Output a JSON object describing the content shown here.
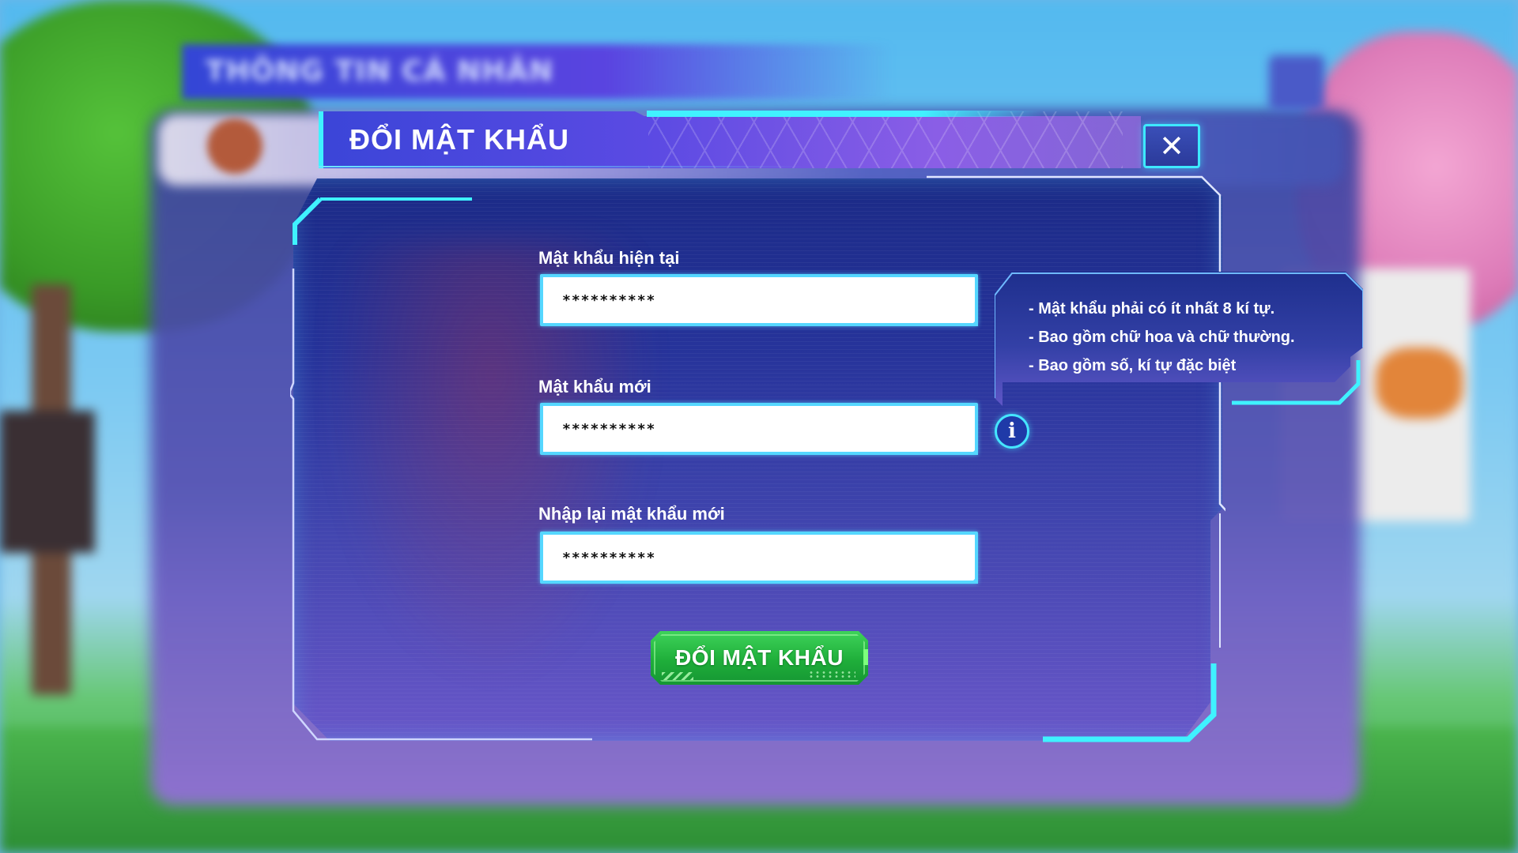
{
  "background": {
    "back_window_title": "THÔNG TIN CÁ NHÂN"
  },
  "dialog": {
    "title": "ĐỔI MẬT KHẨU",
    "close_label": "✕",
    "fields": [
      {
        "label": "Mật khẩu hiện tại",
        "value": "**********"
      },
      {
        "label": "Mật khẩu mới",
        "value": "**********"
      },
      {
        "label": "Nhập lại mật khẩu mới",
        "value": "**********"
      }
    ],
    "requirements": [
      "- Mật khẩu phải có ít nhất 8 kí tự.",
      "- Bao gồm chữ hoa và chữ thường.",
      "- Bao gồm số, kí tự đặc biệt"
    ],
    "info_icon_glyph": "i",
    "submit_label": "ĐỔI MẬT KHẨU"
  },
  "colors": {
    "accent_cyan": "#3ff2ff",
    "panel_blue": "#26339a",
    "button_green": "#1fae3a"
  }
}
